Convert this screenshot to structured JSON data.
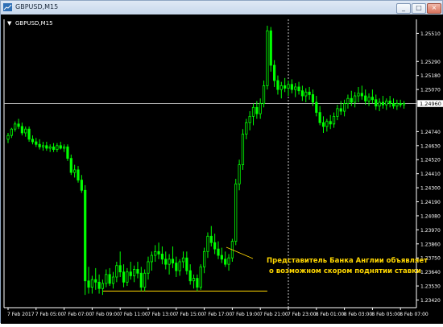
{
  "window": {
    "title": "GBPUSD,M15",
    "buttons": {
      "minimize": "_",
      "maximize": "□",
      "close": "×"
    }
  },
  "chart_header": {
    "label": "GBPUSD,M15",
    "marker": "▼"
  },
  "price_badge": "1.24960",
  "annotation": {
    "line1": "Представитель Банка Англии объявляет",
    "line2": "о возможном скором поднятии ставки"
  },
  "colors": {
    "background": "#000000",
    "candle": "#00ff00",
    "text": "#ffffff",
    "annotation": "#ffd700",
    "support_line": "#ffd700",
    "price_line": "#c0c0c0",
    "period_line": "#ffffff"
  },
  "chart_data": {
    "type": "candlestick",
    "symbol": "GBPUSD",
    "timeframe": "M15",
    "ylim": [
      1.2336,
      1.2562
    ],
    "y_ticks": [
      "1.25510",
      "1.25290",
      "1.25180",
      "1.25070",
      "1.24960",
      "1.24740",
      "1.24630",
      "1.24520",
      "1.24410",
      "1.24300",
      "1.24190",
      "1.24080",
      "1.23970",
      "1.23860",
      "1.23750",
      "1.23640",
      "1.23530",
      "1.23420"
    ],
    "y_tick_values": [
      1.2551,
      1.2529,
      1.2518,
      1.2507,
      1.2496,
      1.2474,
      1.2463,
      1.2452,
      1.2441,
      1.243,
      1.2419,
      1.2408,
      1.2397,
      1.2386,
      1.2375,
      1.2364,
      1.2353,
      1.2342
    ],
    "x_ticks": [
      "7 Feb 2017",
      "7 Feb 05:00",
      "7 Feb 07:00",
      "7 Feb 09:00",
      "7 Feb 11:00",
      "7 Feb 13:00",
      "7 Feb 15:00",
      "7 Feb 17:00",
      "7 Feb 19:00",
      "7 Feb 21:00",
      "7 Feb 23:00",
      "8 Feb 01:00",
      "8 Feb 03:00",
      "8 Feb 05:00",
      "8 Feb 07:00"
    ],
    "x_tick_bars": [
      0,
      8,
      16,
      24,
      32,
      40,
      48,
      56,
      64,
      72,
      80,
      88,
      96,
      104,
      112
    ],
    "current_price": 1.2496,
    "period_separator_bar": 80,
    "support_level": 1.2349,
    "support_from_bar": 27,
    "support_to_bar": 74,
    "candles": [
      [
        1.2468,
        1.2473,
        1.2465,
        1.2471
      ],
      [
        1.2471,
        1.2477,
        1.2469,
        1.2476
      ],
      [
        1.2476,
        1.2482,
        1.2474,
        1.248
      ],
      [
        1.248,
        1.2484,
        1.2476,
        1.2478
      ],
      [
        1.2478,
        1.2481,
        1.2471,
        1.2473
      ],
      [
        1.2473,
        1.2478,
        1.247,
        1.2476
      ],
      [
        1.2476,
        1.2478,
        1.2466,
        1.2468
      ],
      [
        1.2468,
        1.2471,
        1.2464,
        1.2466
      ],
      [
        1.2466,
        1.2469,
        1.2462,
        1.2464
      ],
      [
        1.2464,
        1.2468,
        1.246,
        1.2462
      ],
      [
        1.2462,
        1.2466,
        1.2459,
        1.2463
      ],
      [
        1.2463,
        1.2466,
        1.2459,
        1.2461
      ],
      [
        1.2461,
        1.2464,
        1.2458,
        1.2462
      ],
      [
        1.2462,
        1.2465,
        1.2458,
        1.246
      ],
      [
        1.246,
        1.2465,
        1.2458,
        1.2463
      ],
      [
        1.2463,
        1.2466,
        1.246,
        1.2461
      ],
      [
        1.2461,
        1.2464,
        1.2458,
        1.2462
      ],
      [
        1.2462,
        1.2464,
        1.2451,
        1.2453
      ],
      [
        1.2453,
        1.2456,
        1.244,
        1.2442
      ],
      [
        1.2442,
        1.2448,
        1.2438,
        1.2444
      ],
      [
        1.2444,
        1.2447,
        1.2434,
        1.2436
      ],
      [
        1.2436,
        1.244,
        1.2426,
        1.2428
      ],
      [
        1.2428,
        1.2432,
        1.2346,
        1.2357
      ],
      [
        1.2357,
        1.2368,
        1.2347,
        1.2352
      ],
      [
        1.2352,
        1.2361,
        1.2347,
        1.2358
      ],
      [
        1.2358,
        1.2367,
        1.235,
        1.2356
      ],
      [
        1.2356,
        1.2362,
        1.2347,
        1.2351
      ],
      [
        1.2351,
        1.2358,
        1.2346,
        1.2355
      ],
      [
        1.2355,
        1.2366,
        1.2352,
        1.2362
      ],
      [
        1.2362,
        1.2367,
        1.2353,
        1.2355
      ],
      [
        1.2355,
        1.2364,
        1.2351,
        1.236
      ],
      [
        1.236,
        1.2372,
        1.2356,
        1.2369
      ],
      [
        1.2369,
        1.238,
        1.236,
        1.2364
      ],
      [
        1.2364,
        1.237,
        1.2352,
        1.2356
      ],
      [
        1.2356,
        1.2367,
        1.2353,
        1.2364
      ],
      [
        1.2364,
        1.2372,
        1.2358,
        1.2361
      ],
      [
        1.2361,
        1.2369,
        1.2356,
        1.2366
      ],
      [
        1.2366,
        1.2372,
        1.2359,
        1.2363
      ],
      [
        1.2363,
        1.2368,
        1.2349,
        1.2352
      ],
      [
        1.2352,
        1.2366,
        1.2349,
        1.2363
      ],
      [
        1.2363,
        1.2376,
        1.2358,
        1.2372
      ],
      [
        1.2372,
        1.238,
        1.2365,
        1.2377
      ],
      [
        1.2377,
        1.2385,
        1.2372,
        1.238
      ],
      [
        1.238,
        1.2387,
        1.2374,
        1.2378
      ],
      [
        1.2378,
        1.2384,
        1.237,
        1.2374
      ],
      [
        1.2374,
        1.238,
        1.2366,
        1.237
      ],
      [
        1.237,
        1.2378,
        1.2362,
        1.2374
      ],
      [
        1.2374,
        1.2384,
        1.2367,
        1.2371
      ],
      [
        1.2371,
        1.2376,
        1.236,
        1.2365
      ],
      [
        1.2365,
        1.2374,
        1.2361,
        1.2372
      ],
      [
        1.2372,
        1.238,
        1.2367,
        1.2375
      ],
      [
        1.2375,
        1.238,
        1.2362,
        1.2365
      ],
      [
        1.2365,
        1.237,
        1.2354,
        1.2357
      ],
      [
        1.2357,
        1.2362,
        1.2351,
        1.2359
      ],
      [
        1.2359,
        1.2362,
        1.2349,
        1.2352
      ],
      [
        1.2352,
        1.237,
        1.235,
        1.2368
      ],
      [
        1.2368,
        1.2383,
        1.2363,
        1.238
      ],
      [
        1.238,
        1.2395,
        1.2375,
        1.2392
      ],
      [
        1.2392,
        1.24,
        1.2384,
        1.2387
      ],
      [
        1.2387,
        1.2394,
        1.2378,
        1.2382
      ],
      [
        1.2382,
        1.2388,
        1.2374,
        1.2377
      ],
      [
        1.2377,
        1.2383,
        1.2371,
        1.2374
      ],
      [
        1.2374,
        1.238,
        1.2368,
        1.237
      ],
      [
        1.237,
        1.2378,
        1.2365,
        1.2375
      ],
      [
        1.2375,
        1.239,
        1.2372,
        1.2388
      ],
      [
        1.2388,
        1.2437,
        1.2385,
        1.2433
      ],
      [
        1.2433,
        1.2452,
        1.2428,
        1.2448
      ],
      [
        1.2448,
        1.2476,
        1.2444,
        1.2472
      ],
      [
        1.2472,
        1.2484,
        1.2468,
        1.2481
      ],
      [
        1.2481,
        1.249,
        1.2475,
        1.2486
      ],
      [
        1.2486,
        1.2496,
        1.2479,
        1.2493
      ],
      [
        1.2493,
        1.2498,
        1.2484,
        1.2488
      ],
      [
        1.2488,
        1.25,
        1.2484,
        1.2496
      ],
      [
        1.2496,
        1.2514,
        1.2493,
        1.251
      ],
      [
        1.251,
        1.2557,
        1.2507,
        1.2553
      ],
      [
        1.2553,
        1.2556,
        1.2521,
        1.2526
      ],
      [
        1.2526,
        1.253,
        1.2509,
        1.2514
      ],
      [
        1.2514,
        1.2518,
        1.2503,
        1.2507
      ],
      [
        1.2507,
        1.2513,
        1.25,
        1.251
      ],
      [
        1.251,
        1.2516,
        1.2505,
        1.2508
      ],
      [
        1.2508,
        1.2514,
        1.2502,
        1.2511
      ],
      [
        1.2511,
        1.2515,
        1.2504,
        1.2507
      ],
      [
        1.2507,
        1.2512,
        1.2501,
        1.2509
      ],
      [
        1.2509,
        1.2513,
        1.2503,
        1.2506
      ],
      [
        1.2506,
        1.251,
        1.2498,
        1.2502
      ],
      [
        1.2502,
        1.2508,
        1.2497,
        1.2505
      ],
      [
        1.2505,
        1.2509,
        1.2499,
        1.2503
      ],
      [
        1.2503,
        1.2507,
        1.2494,
        1.2497
      ],
      [
        1.2497,
        1.2502,
        1.2486,
        1.2489
      ],
      [
        1.2489,
        1.2494,
        1.2479,
        1.2481
      ],
      [
        1.2481,
        1.2486,
        1.2473,
        1.2478
      ],
      [
        1.2478,
        1.2484,
        1.2474,
        1.2482
      ],
      [
        1.2482,
        1.2487,
        1.2476,
        1.248
      ],
      [
        1.248,
        1.2489,
        1.2477,
        1.2486
      ],
      [
        1.2486,
        1.2495,
        1.2483,
        1.2492
      ],
      [
        1.2492,
        1.2498,
        1.2487,
        1.249
      ],
      [
        1.249,
        1.2499,
        1.2486,
        1.2496
      ],
      [
        1.2496,
        1.2503,
        1.2492,
        1.25
      ],
      [
        1.25,
        1.2506,
        1.2494,
        1.2497
      ],
      [
        1.2497,
        1.2505,
        1.2493,
        1.2502
      ],
      [
        1.2502,
        1.2509,
        1.2497,
        1.2504
      ],
      [
        1.2504,
        1.251,
        1.2499,
        1.2502
      ],
      [
        1.2502,
        1.2507,
        1.2495,
        1.2498
      ],
      [
        1.2498,
        1.2504,
        1.2494,
        1.2501
      ],
      [
        1.2501,
        1.2507,
        1.2496,
        1.2499
      ],
      [
        1.2499,
        1.2503,
        1.2491,
        1.2494
      ],
      [
        1.2494,
        1.25,
        1.249,
        1.2497
      ],
      [
        1.2497,
        1.2502,
        1.2492,
        1.2495
      ],
      [
        1.2495,
        1.25,
        1.2491,
        1.2498
      ],
      [
        1.2498,
        1.2502,
        1.2493,
        1.2496
      ],
      [
        1.2496,
        1.25,
        1.2492,
        1.2494
      ],
      [
        1.2494,
        1.2499,
        1.2491,
        1.2496
      ],
      [
        1.2496,
        1.2499,
        1.2493,
        1.2495
      ],
      [
        1.2495,
        1.2498,
        1.2492,
        1.2496
      ]
    ]
  }
}
